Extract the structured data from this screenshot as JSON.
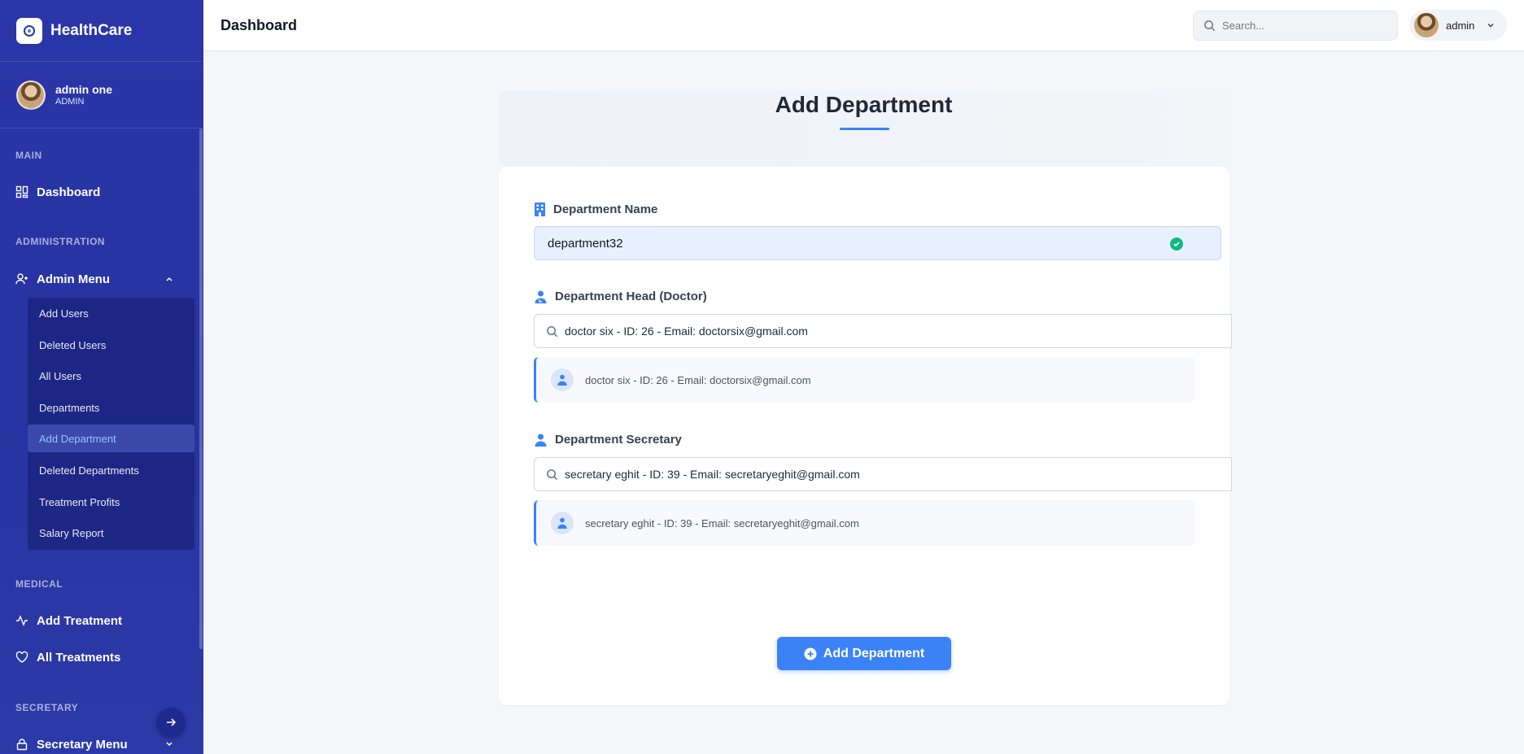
{
  "sidebar": {
    "brand": "HealthCare",
    "user_name": "admin one",
    "user_role": "ADMIN",
    "sections": {
      "main": "MAIN",
      "administration": "ADMINISTRATION",
      "medical": "MEDICAL",
      "secretary": "SECRETARY"
    },
    "items": {
      "dashboard": "Dashboard",
      "admin_menu": "Admin Menu",
      "add_treatment": "Add Treatment",
      "all_treatments": "All Treatments",
      "secretary_menu": "Secretary Menu"
    },
    "admin_submenu": [
      "Add Users",
      "Deleted Users",
      "All Users",
      "Departments",
      "Add Department",
      "Deleted Departments",
      "Treatment Profits",
      "Salary Report"
    ],
    "active_submenu": "Add Department"
  },
  "topbar": {
    "title": "Dashboard",
    "search_placeholder": "Search...",
    "user_name": "admin"
  },
  "form": {
    "title": "Add Department",
    "department_name_label": "Department Name",
    "department_name_value": "department32",
    "head_label": "Department Head (Doctor)",
    "head_search_value": "doctor six - ID: 26 - Email: doctorsix@gmail.com",
    "head_result": "doctor six - ID: 26 - Email: doctorsix@gmail.com",
    "secretary_label": "Department Secretary",
    "secretary_search_value": "secretary eghit - ID: 39 - Email: secretaryeghit@gmail.com",
    "secretary_result": "secretary eghit - ID: 39 - Email: secretaryeghit@gmail.com",
    "submit_label": "Add Department"
  },
  "colors": {
    "sidebar_bg": "#2a36a8",
    "accent": "#3b82f6",
    "success": "#10b981"
  }
}
